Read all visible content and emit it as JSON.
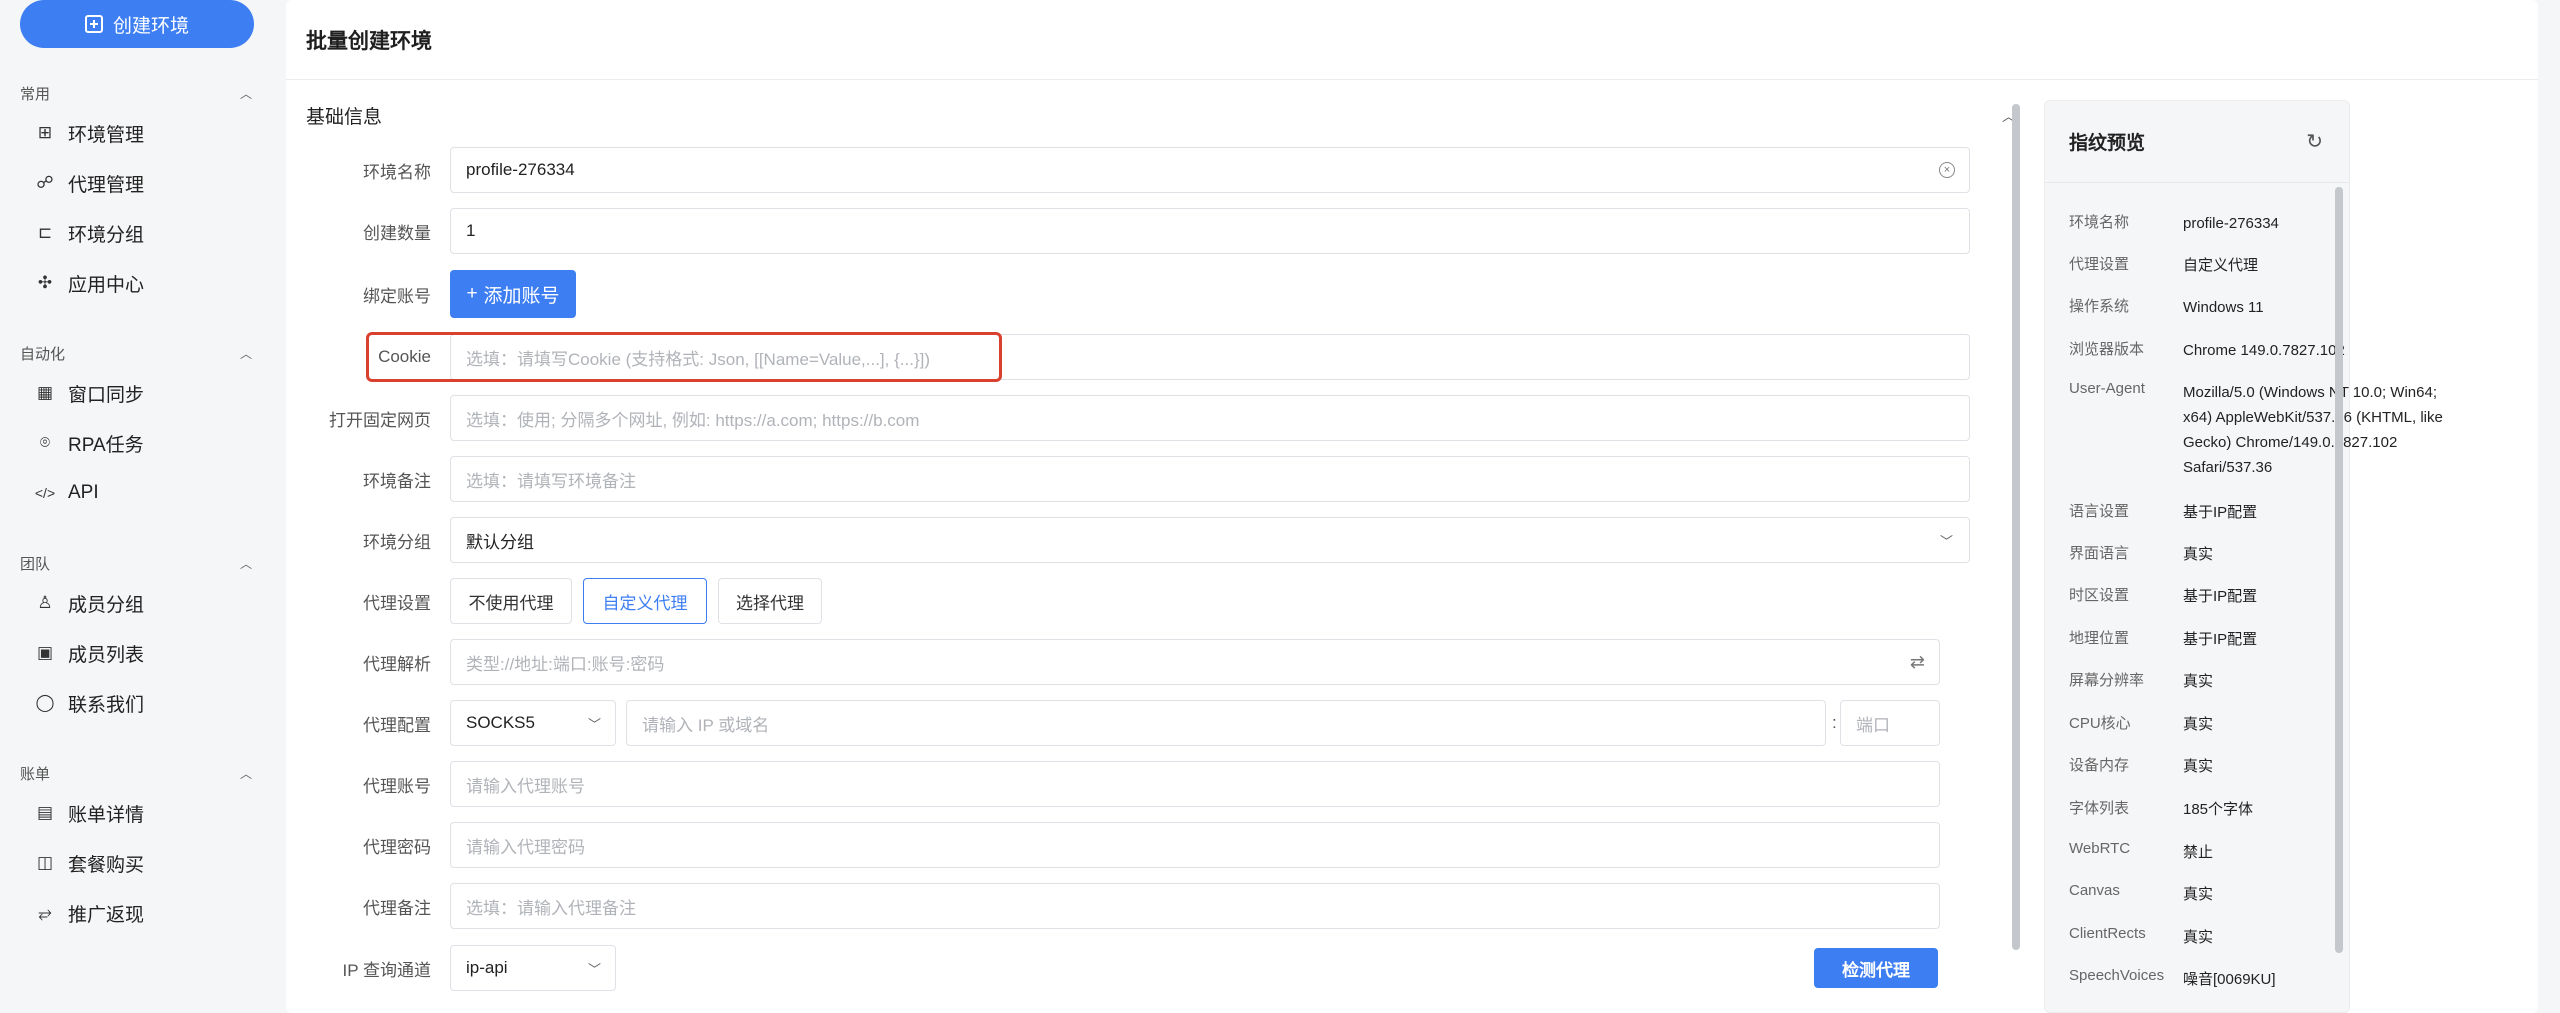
{
  "sidebar": {
    "create_button": "创建环境",
    "groups": [
      {
        "title": "常用",
        "items": [
          {
            "label": "环境管理",
            "icon": "grid-icon"
          },
          {
            "label": "代理管理",
            "icon": "share-nodes-icon"
          },
          {
            "label": "环境分组",
            "icon": "tree-icon"
          },
          {
            "label": "应用中心",
            "icon": "puzzle-icon"
          }
        ]
      },
      {
        "title": "自动化",
        "items": [
          {
            "label": "窗口同步",
            "icon": "table-icon"
          },
          {
            "label": "RPA任务",
            "icon": "target-icon"
          },
          {
            "label": "API",
            "icon": "code-icon"
          }
        ]
      },
      {
        "title": "团队",
        "items": [
          {
            "label": "成员分组",
            "icon": "user-icon"
          },
          {
            "label": "成员列表",
            "icon": "user-card-icon"
          },
          {
            "label": "联系我们",
            "icon": "chat-icon"
          }
        ]
      },
      {
        "title": "账单",
        "items": [
          {
            "label": "账单详情",
            "icon": "bill-icon"
          },
          {
            "label": "套餐购买",
            "icon": "bag-icon"
          },
          {
            "label": "推广返现",
            "icon": "rebate-icon"
          }
        ]
      }
    ]
  },
  "page": {
    "title": "批量创建环境",
    "section_title": "基础信息"
  },
  "form": {
    "env_name_label": "环境名称",
    "env_name_value": "profile-276334",
    "count_label": "创建数量",
    "count_value": "1",
    "bind_account_label": "绑定账号",
    "add_account_button": "添加账号",
    "cookie_label": "Cookie",
    "cookie_placeholder": "选填：请填写Cookie (支持格式: Json, [[Name=Value,...], {...}])",
    "open_pages_label": "打开固定网页",
    "open_pages_placeholder": "选填：使用; 分隔多个网址, 例如: https://a.com; https://b.com",
    "env_note_label": "环境备注",
    "env_note_placeholder": "选填：请填写环境备注",
    "env_group_label": "环境分组",
    "env_group_value": "默认分组",
    "proxy_setting_label": "代理设置",
    "proxy_options": [
      "不使用代理",
      "自定义代理",
      "选择代理"
    ],
    "proxy_parse_label": "代理解析",
    "proxy_parse_placeholder": "类型://地址:端口:账号:密码",
    "proxy_config_label": "代理配置",
    "proxy_type_value": "SOCKS5",
    "proxy_host_placeholder": "请输入 IP 或域名",
    "proxy_port_placeholder": "端口",
    "proxy_colon": ":",
    "proxy_account_label": "代理账号",
    "proxy_account_placeholder": "请输入代理账号",
    "proxy_password_label": "代理密码",
    "proxy_password_placeholder": "请输入代理密码",
    "proxy_note_label": "代理备注",
    "proxy_note_placeholder": "选填：请输入代理备注",
    "ip_channel_label": "IP 查询通道",
    "ip_channel_value": "ip-api",
    "check_proxy_button": "检测代理"
  },
  "fingerprint": {
    "title": "指纹预览",
    "rows": [
      {
        "key": "环境名称",
        "value": "profile-276334"
      },
      {
        "key": "代理设置",
        "value": "自定义代理"
      },
      {
        "key": "操作系统",
        "value": "Windows 11"
      },
      {
        "key": "浏览器版本",
        "value": "Chrome 149.0.7827.102"
      },
      {
        "key": "User-Agent",
        "value": "Mozilla/5.0 (Windows NT 10.0; Win64; x64) AppleWebKit/537.36 (KHTML, like Gecko) Chrome/149.0.7827.102 Safari/537.36"
      },
      {
        "key": "语言设置",
        "value": "基于IP配置"
      },
      {
        "key": "界面语言",
        "value": "真实"
      },
      {
        "key": "时区设置",
        "value": "基于IP配置"
      },
      {
        "key": "地理位置",
        "value": "基于IP配置"
      },
      {
        "key": "屏幕分辨率",
        "value": "真实"
      },
      {
        "key": "CPU核心",
        "value": "真实"
      },
      {
        "key": "设备内存",
        "value": "真实"
      },
      {
        "key": "字体列表",
        "value": "185个字体"
      },
      {
        "key": "WebRTC",
        "value": "禁止"
      },
      {
        "key": "Canvas",
        "value": "真实"
      },
      {
        "key": "ClientRects",
        "value": "真实"
      },
      {
        "key": "SpeechVoices",
        "value": "噪音[0069KU]"
      }
    ]
  }
}
